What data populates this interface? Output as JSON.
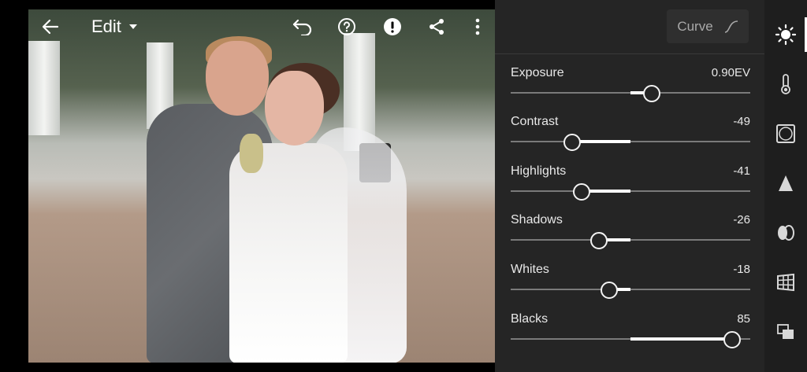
{
  "toolbar": {
    "edit_label": "Edit"
  },
  "panel": {
    "curve_label": "Curve",
    "sliders": [
      {
        "label": "Exposure",
        "value": "0.90EV",
        "position": 0.59
      },
      {
        "label": "Contrast",
        "value": "-49",
        "position": 0.255
      },
      {
        "label": "Highlights",
        "value": "-41",
        "position": 0.295
      },
      {
        "label": "Shadows",
        "value": "-26",
        "position": 0.37
      },
      {
        "label": "Whites",
        "value": "-18",
        "position": 0.41
      },
      {
        "label": "Blacks",
        "value": "85",
        "position": 0.925
      }
    ]
  },
  "tools": [
    {
      "icon": "light-icon",
      "active": true
    },
    {
      "icon": "color-icon"
    },
    {
      "icon": "effects-icon"
    },
    {
      "icon": "detail-icon"
    },
    {
      "icon": "optics-icon"
    },
    {
      "icon": "geometry-icon"
    },
    {
      "icon": "versions-icon"
    }
  ],
  "colors": {
    "panel_bg": "#252525",
    "strip_bg": "#1e1e1e",
    "accent": "#ffffff"
  }
}
